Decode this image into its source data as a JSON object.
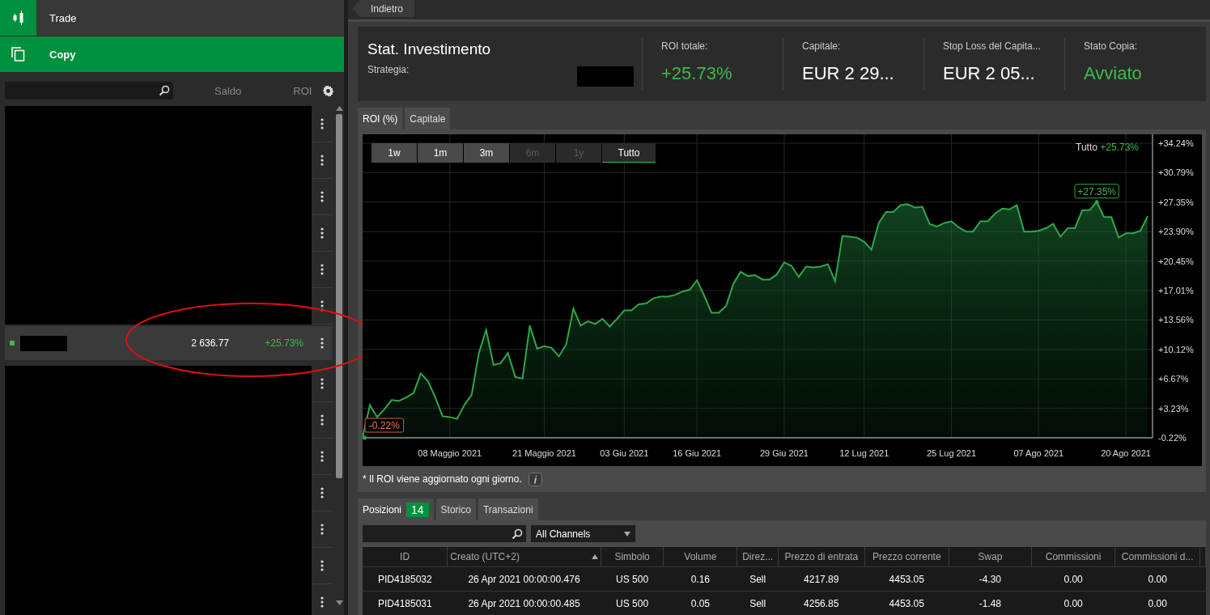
{
  "nav": [
    {
      "label": "Trade",
      "selected": false
    },
    {
      "label": "Copy",
      "selected": true
    }
  ],
  "sidebar": {
    "columns": [
      "Saldo",
      "ROI"
    ],
    "rows": [
      {
        "kind": "redacted"
      },
      {
        "kind": "redacted"
      },
      {
        "kind": "redacted"
      },
      {
        "kind": "redacted"
      },
      {
        "kind": "redacted"
      },
      {
        "kind": "redacted"
      },
      {
        "kind": "strategy",
        "active": true,
        "balance": "2 636.77",
        "roi": "+25.73%",
        "highlighted": true
      },
      {
        "kind": "redacted"
      },
      {
        "kind": "redacted"
      },
      {
        "kind": "redacted"
      },
      {
        "kind": "redacted"
      },
      {
        "kind": "redacted"
      },
      {
        "kind": "redacted"
      },
      {
        "kind": "redacted"
      }
    ]
  },
  "back_button": "Indietro",
  "header": {
    "title": "Stat. Investimento",
    "strategy_label": "Strategia:",
    "stats": [
      {
        "label": "ROI totale:",
        "value": "+25.73%",
        "positive": true
      },
      {
        "label": "Capitale:",
        "value": "EUR 2 29...",
        "positive": false
      },
      {
        "label": "Stop Loss del Capita...",
        "value": "EUR 2 05...",
        "positive": false
      },
      {
        "label": "Stato Copia:",
        "value": "Avviato",
        "positive": true
      }
    ]
  },
  "chart_tabs": [
    {
      "label": "ROI (%)",
      "selected": true
    },
    {
      "label": "Capitale",
      "selected": false
    }
  ],
  "ranges": [
    {
      "label": "1w",
      "disabled": false,
      "selected": false
    },
    {
      "label": "1m",
      "disabled": false,
      "selected": false
    },
    {
      "label": "3m",
      "disabled": false,
      "selected": false
    },
    {
      "label": "6m",
      "disabled": true,
      "selected": false
    },
    {
      "label": "1y",
      "disabled": true,
      "selected": false
    },
    {
      "label": "Tutto",
      "disabled": false,
      "selected": true
    }
  ],
  "legend": {
    "label": "Tutto",
    "value": "+25.73%"
  },
  "chart_data": {
    "type": "area",
    "grid": true,
    "ylim": [
      -0.22,
      34.24
    ],
    "categories": [
      null,
      null,
      null,
      null,
      null,
      null,
      null,
      null,
      null,
      null,
      null,
      null,
      "08 Maggio 2021",
      null,
      null,
      null,
      null,
      null,
      null,
      null,
      null,
      null,
      null,
      null,
      null,
      "21 Maggio 2021",
      null,
      null,
      null,
      null,
      null,
      null,
      null,
      null,
      null,
      null,
      "03 Giu 2021",
      null,
      null,
      null,
      null,
      null,
      null,
      null,
      null,
      null,
      "16 Giu 2021",
      null,
      null,
      null,
      null,
      null,
      null,
      null,
      null,
      null,
      null,
      null,
      "29 Giu 2021",
      null,
      null,
      null,
      null,
      null,
      null,
      null,
      null,
      null,
      null,
      "12 Lug 2021",
      null,
      null,
      null,
      null,
      null,
      null,
      null,
      null,
      null,
      null,
      null,
      "25 Lug 2021",
      null,
      null,
      null,
      null,
      null,
      null,
      null,
      null,
      null,
      null,
      null,
      "07 Ago 2021",
      null,
      null,
      null,
      null,
      null,
      null,
      null,
      null,
      null,
      null,
      null,
      "20 Ago 2021",
      null,
      null,
      null
    ],
    "values": [
      -0.2,
      3.6,
      2.2,
      3.1,
      4.2,
      4.1,
      4.5,
      5.0,
      7.3,
      6.4,
      4.5,
      2.3,
      2.2,
      2.0,
      3.6,
      4.8,
      9.7,
      12.4,
      8.3,
      8.5,
      9.7,
      6.9,
      6.7,
      12.9,
      10.2,
      10.5,
      10.3,
      9.3,
      10.7,
      14.9,
      12.9,
      13.4,
      13.1,
      13.7,
      12.8,
      13.7,
      14.7,
      14.7,
      15.4,
      15.5,
      16.1,
      16.3,
      16.3,
      16.5,
      16.9,
      17.1,
      18.2,
      16.4,
      14.4,
      14.4,
      15.2,
      17.8,
      19.2,
      18.7,
      18.8,
      18.3,
      18.3,
      18.9,
      20.3,
      19.9,
      18.6,
      19.8,
      19.7,
      19.8,
      20.1,
      18.1,
      23.4,
      23.3,
      23.2,
      22.7,
      21.8,
      24.9,
      26.2,
      26.2,
      27.0,
      27.1,
      26.7,
      26.8,
      24.8,
      24.5,
      24.9,
      25.1,
      24.4,
      23.9,
      23.9,
      25.1,
      25.1,
      26.0,
      26.6,
      26.5,
      27.0,
      23.9,
      23.9,
      24.0,
      24.3,
      24.8,
      23.3,
      24.3,
      24.3,
      26.4,
      26.4,
      27.4,
      25.6,
      25.6,
      23.2,
      23.7,
      23.7,
      24.0,
      25.7
    ],
    "yticks": [
      {
        "value": 34.24,
        "label": "+34.24%"
      },
      {
        "value": 30.79,
        "label": "+30.79%"
      },
      {
        "value": 27.35,
        "label": "+27.35%"
      },
      {
        "value": 23.9,
        "label": "+23.90%"
      },
      {
        "value": 20.45,
        "label": "+20.45%"
      },
      {
        "value": 17.01,
        "label": "+17.01%"
      },
      {
        "value": 13.56,
        "label": "+13.56%"
      },
      {
        "value": 10.12,
        "label": "+10.12%"
      },
      {
        "value": 6.67,
        "label": "+6.67%"
      },
      {
        "value": 3.23,
        "label": "+3.23%"
      },
      {
        "value": -0.22,
        "label": "-0.22%"
      }
    ],
    "annotations": [
      {
        "y": -0.22,
        "text": "-0.22%"
      },
      {
        "y": 27.35,
        "text": "+27.35%"
      }
    ]
  },
  "chart_note": "* Il ROI viene aggiornato ogni giorno.",
  "position_tabs": [
    {
      "label": "Posizioni",
      "badge": "14",
      "selected": true
    },
    {
      "label": "Storico",
      "selected": false
    },
    {
      "label": "Transazioni",
      "selected": false
    }
  ],
  "filters": {
    "channel": "All Channels"
  },
  "table": {
    "columns": [
      {
        "label": "ID",
        "sorted": false
      },
      {
        "label": "Creato (UTC+2)",
        "sorted": true
      },
      {
        "label": "Simbolo",
        "sorted": false
      },
      {
        "label": "Volume",
        "sorted": false
      },
      {
        "label": "Direz...",
        "sorted": false
      },
      {
        "label": "Prezzo di entrata",
        "sorted": false
      },
      {
        "label": "Prezzo corrente",
        "sorted": false
      },
      {
        "label": "Swap",
        "sorted": false
      },
      {
        "label": "Commissioni",
        "sorted": false
      },
      {
        "label": "Commissioni d...",
        "sorted": false
      }
    ],
    "rows": [
      [
        "PID4185032",
        "26 Apr 2021 00:00:00.476",
        "US 500",
        "0.16",
        "Sell",
        "4217.89",
        "4453.05",
        "-4.30",
        "0.00",
        "0.00"
      ],
      [
        "PID4185031",
        "26 Apr 2021 00:00:00.485",
        "US 500",
        "0.05",
        "Sell",
        "4256.85",
        "4453.05",
        "-1.48",
        "0.00",
        "0.00"
      ]
    ]
  }
}
